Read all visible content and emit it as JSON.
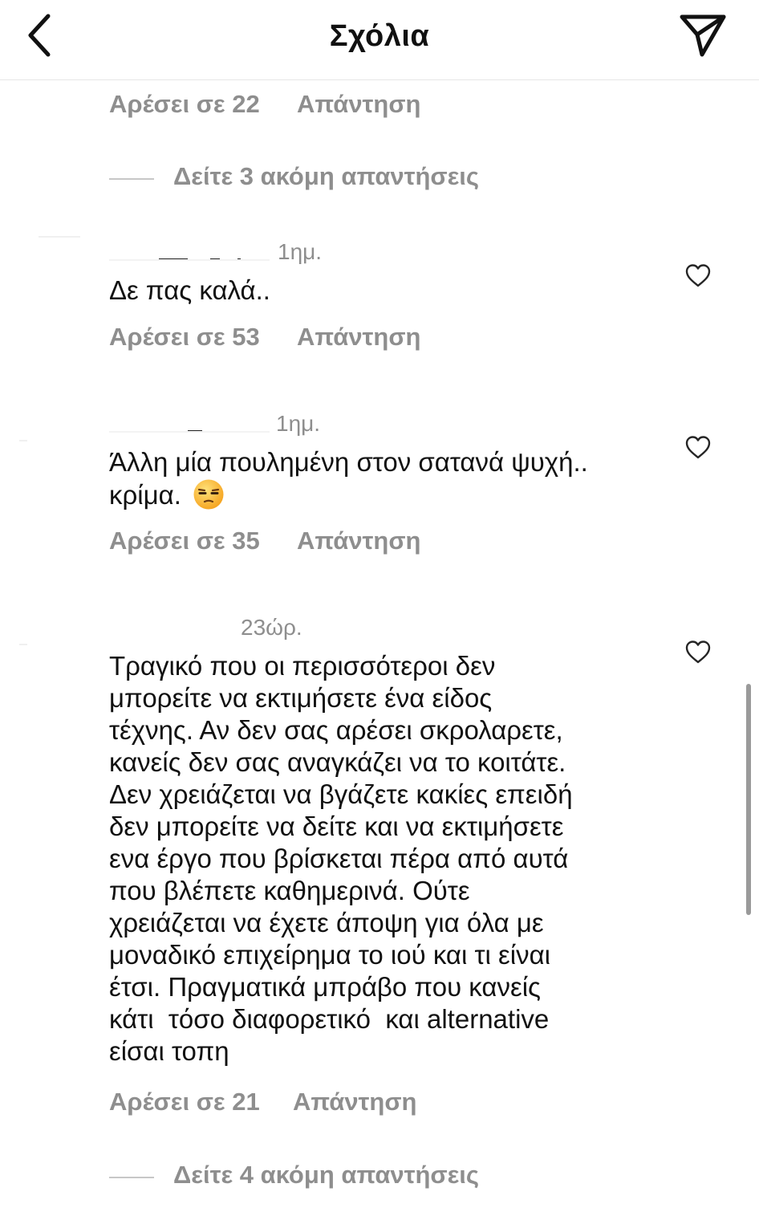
{
  "header": {
    "title": "Σχόλια",
    "back_icon": "chevron-left-icon",
    "send_icon": "paper-plane-icon"
  },
  "top_meta": {
    "likes": "Αρέσει σε 22",
    "reply": "Απάντηση"
  },
  "view_more_1": "Δείτε 3 ακόμη απαντήσεις",
  "comments": [
    {
      "time": "1ημ.",
      "text": "Δε πας καλά..",
      "likes": "Αρέσει σε 53",
      "reply": "Απάντηση"
    },
    {
      "time": "1ημ.",
      "text": "Άλλη μία πουλημένη στον σατανά ψυχή..\nκρίμα.",
      "emoji": "unamused-face",
      "likes": "Αρέσει σε 35",
      "reply": "Απάντηση"
    },
    {
      "time": "23ώρ.",
      "text": "Τραγικό που οι περισσότεροι δεν\nμπορείτε να εκτιμήσετε ένα είδος\nτέχνης. Αν δεν σας αρέσει σκρολαρετε,\nκανείς δεν σας αναγκάζει να το κοιτάτε.\nΔεν χρειάζεται να βγάζετε κακίες επειδή\nδεν μπορείτε να δείτε και να εκτιμήσετε\nενα έργο που βρίσκεται πέρα από αυτά\nπου βλέπετε καθημερινά. Ούτε\nχρειάζεται να έχετε άποψη για όλα με\nμοναδικό επιχείρημα το ιού και τι είναι\nέτσι. Πραγματικά μπράβο που κανείς\nκάτι  τόσο διαφορετικό  και alternative\nείσαι τοπη",
      "likes": "Αρέσει σε 21",
      "reply": "Απάντηση"
    }
  ],
  "view_more_2": "Δείτε 4 ακόμη απαντήσεις",
  "heart_icon": "heart-outline-icon",
  "colors": {
    "text": "#111111",
    "secondary": "#8e8e8e",
    "divider": "#e6e6e6"
  }
}
